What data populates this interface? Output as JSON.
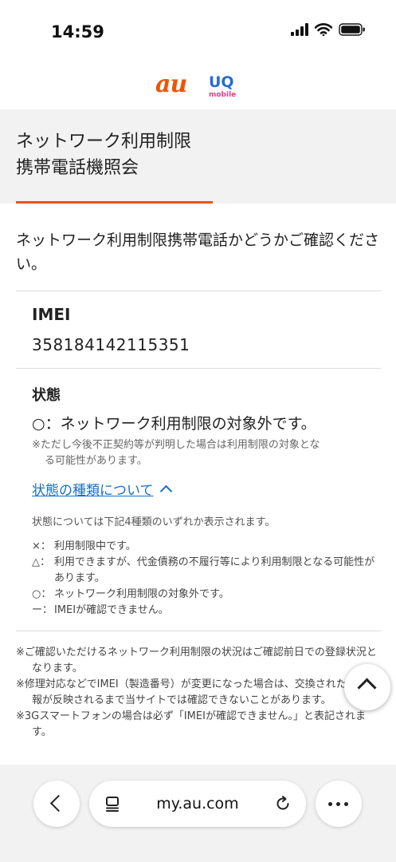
{
  "statusbar": {
    "time": "14:59",
    "icons": [
      "signal-icon",
      "wifi-icon",
      "battery-icon"
    ]
  },
  "logo": {
    "au": "au",
    "uq": "UQ",
    "mobile": "mobile"
  },
  "page": {
    "title_line1": "ネットワーク利用制限",
    "title_line2": "携帯電話機照会",
    "intro": "ネットワーク利用制限携帯電話かどうかご確認ください。"
  },
  "imei": {
    "label": "IMEI",
    "value": "358184142115351"
  },
  "status": {
    "label": "状態",
    "value": "○：ネットワーク利用制限の対象外です。",
    "note_line1": "※ただし今後不正契約等が判明した場合は利用制限の対象とな",
    "note_line2": "る可能性があります。"
  },
  "types": {
    "link_label": "状態の種類について",
    "description": "状態については下記4種類のいずれか表示されます。",
    "items": [
      {
        "symbol": "×：",
        "text": "利用制限中です。"
      },
      {
        "symbol": "△：",
        "text": "利用できますが、代金債務の不履行等により利用制限となる可能性があります。"
      },
      {
        "symbol": "○：",
        "text": "ネットワーク利用制限の対象外です。"
      },
      {
        "symbol": "ー：",
        "text": "IMEIが確認できません。"
      }
    ]
  },
  "footnotes": [
    "※ご確認いただけるネットワーク利用制限の状況はご確認前日での登録状況となります。",
    "※修理対応などでIMEI（製造番号）が変更になった場合は、交換された旨の情報が反映されるまで当サイトでは確認できないことがあります。",
    "※3Gスマートフォンの場合は必ず「IMEIが確認できません。」と表記されます。"
  ],
  "browser": {
    "url": "my.au.com"
  },
  "colors": {
    "accent": "#eb5505",
    "link": "#1a6fbf",
    "band": "#f2f2f2"
  }
}
